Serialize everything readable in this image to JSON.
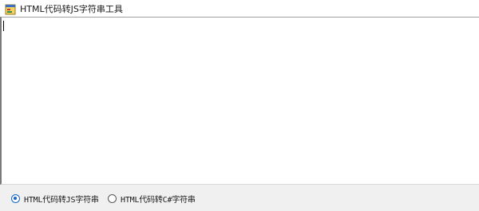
{
  "window": {
    "title": "HTML代码转JS字符串工具",
    "icon": "app-window-icon"
  },
  "editor": {
    "value": ""
  },
  "options": {
    "items": [
      {
        "label": "HTML代码转JS字符串",
        "checked": true
      },
      {
        "label": "HTML代码转C#字符串",
        "checked": false
      }
    ]
  },
  "colors": {
    "accent": "#1466c6",
    "window_bg": "#f0f0f0",
    "editor_bg": "#ffffff"
  }
}
